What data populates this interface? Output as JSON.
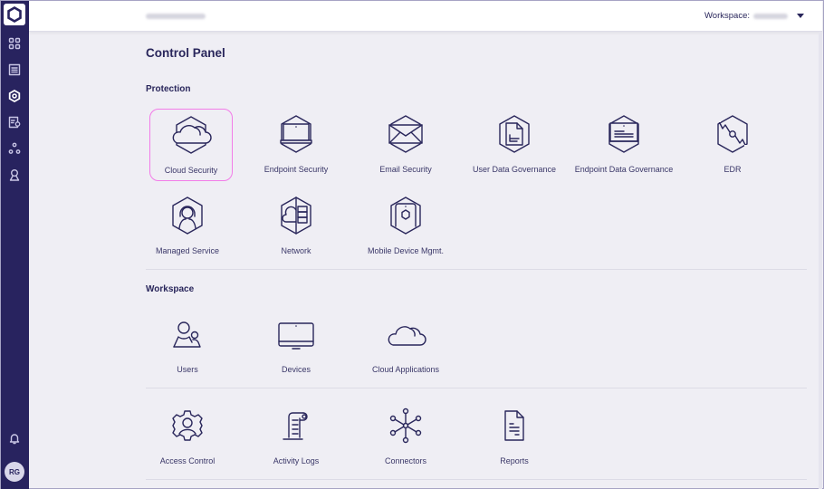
{
  "header": {
    "workspace_label": "Workspace:"
  },
  "sidebar": {
    "items": [
      {
        "name": "dashboard",
        "icon": "grid-icon"
      },
      {
        "name": "list",
        "icon": "list-icon"
      },
      {
        "name": "control-panel",
        "icon": "hexagon-gear-icon",
        "active": true
      },
      {
        "name": "settings-doc",
        "icon": "document-gear-icon"
      },
      {
        "name": "connections",
        "icon": "nodes-icon"
      },
      {
        "name": "support",
        "icon": "agent-icon"
      }
    ],
    "notifications_icon": "bell-icon",
    "avatar_initials": "RG"
  },
  "main": {
    "title": "Control Panel",
    "sections": [
      {
        "title": "Protection",
        "tiles": [
          {
            "label": "Cloud Security",
            "icon": "cloud-hex-icon",
            "selected": true
          },
          {
            "label": "Endpoint Security",
            "icon": "laptop-hex-icon"
          },
          {
            "label": "Email Security",
            "icon": "envelope-hex-icon"
          },
          {
            "label": "User Data Governance",
            "icon": "document-hex-icon"
          },
          {
            "label": "Endpoint Data Governance",
            "icon": "monitor-data-hex-icon"
          },
          {
            "label": "EDR",
            "icon": "edr-hex-icon"
          },
          {
            "label": "Managed Service",
            "icon": "headset-hex-icon"
          },
          {
            "label": "Network",
            "icon": "network-hex-icon"
          },
          {
            "label": "Mobile Device Mgmt.",
            "icon": "mobile-hex-icon"
          }
        ]
      },
      {
        "title": "Workspace",
        "tiles": [
          {
            "label": "Users",
            "icon": "users-icon"
          },
          {
            "label": "Devices",
            "icon": "monitor-icon"
          },
          {
            "label": "Cloud Applications",
            "icon": "cloud-icon"
          }
        ]
      },
      {
        "title": "",
        "tiles": [
          {
            "label": "Access Control",
            "icon": "user-gear-icon"
          },
          {
            "label": "Activity Logs",
            "icon": "scroll-icon"
          },
          {
            "label": "Connectors",
            "icon": "hub-icon"
          },
          {
            "label": "Reports",
            "icon": "report-icon"
          }
        ]
      }
    ]
  },
  "colors": {
    "sidebar_bg": "#28235f",
    "accent_text": "#29265b",
    "selection_border": "#f27ce8",
    "page_bg": "#efeef4"
  }
}
